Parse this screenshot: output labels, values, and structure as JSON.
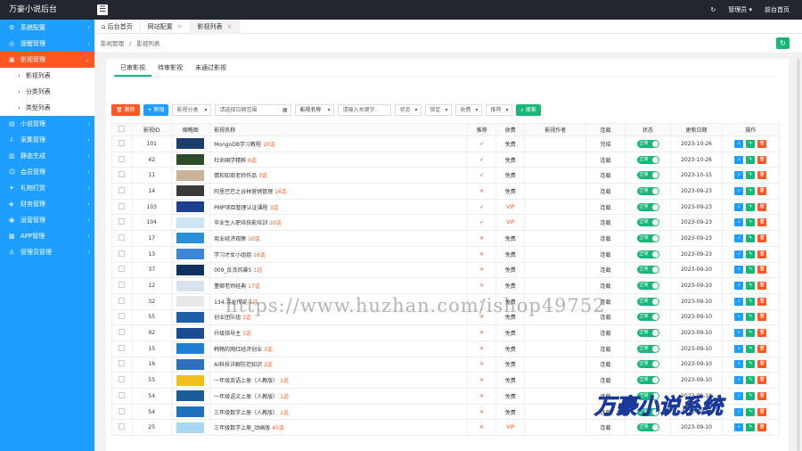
{
  "app": {
    "title": "万豪小说后台"
  },
  "top": {
    "user": "管理员 ▾",
    "home": "前台首页"
  },
  "sidebar": {
    "items": [
      {
        "label": "系统配置",
        "icon": "gear-icon"
      },
      {
        "label": "提醒管理",
        "icon": "bell-icon"
      },
      {
        "label": "影视管理",
        "icon": "film-icon"
      },
      {
        "label": "小说管理",
        "icon": "book-icon"
      },
      {
        "label": "采集管理",
        "icon": "download-icon"
      },
      {
        "label": "静态生成",
        "icon": "file-icon"
      },
      {
        "label": "会员管理",
        "icon": "user-icon"
      },
      {
        "label": "礼物打赏",
        "icon": "gift-icon"
      },
      {
        "label": "财务管理",
        "icon": "wallet-icon"
      },
      {
        "label": "运营管理",
        "icon": "chart-icon"
      },
      {
        "label": "APP管理",
        "icon": "app-icon"
      },
      {
        "label": "管理员管理",
        "icon": "admin-icon"
      }
    ],
    "sub": [
      "影视列表",
      "分类列表",
      "类型列表"
    ]
  },
  "tabs": [
    "后台首页",
    "网站配置",
    "影视列表"
  ],
  "crumb": {
    "a": "影视管理",
    "sep": "/",
    "b": "影视列表"
  },
  "subtabs": [
    "已审影视",
    "待审影视",
    "未通过影视"
  ],
  "toolbar": {
    "del": "删除",
    "add": "+ 新增",
    "cat": "影视分类",
    "date_ph": "请选择日期范围",
    "name_lab": "影视名称",
    "kw_ph": "请输入关键字",
    "status": "状态",
    "lock": "锁定",
    "fee": "收费",
    "rec": "推荐",
    "search": "搜索"
  },
  "table": {
    "headers": [
      "影视ID",
      "缩略图",
      "影视名称",
      "推荐",
      "收费",
      "影视作者",
      "连载",
      "状态",
      "更新日期",
      "操作"
    ],
    "rows": [
      {
        "id": "101",
        "name": "MongoDB学习教程",
        "ep": "10话",
        "rec": "✓",
        "fee": "免费",
        "serial": "完结",
        "date": "2023-10-26",
        "thumb": "#1c3d6e"
      },
      {
        "id": "42",
        "name": "杜命国学精粹",
        "ep": "6话",
        "rec": "✓",
        "fee": "免费",
        "serial": "连载",
        "date": "2023-10-26",
        "thumb": "#2d4a2a"
      },
      {
        "id": "11",
        "name": "情和知商老师作品",
        "ep": "3话",
        "rec": "✓",
        "fee": "免费",
        "serial": "连载",
        "date": "2023-10-15",
        "thumb": "#c9b39a"
      },
      {
        "id": "14",
        "name": "阿里巴巴之谷林营销管理",
        "ep": "16话",
        "rec": "✕",
        "fee": "免费",
        "serial": "连载",
        "date": "2023-09-23",
        "thumb": "#3a3a3a"
      },
      {
        "id": "103",
        "name": "PMP项目管理认证课程",
        "ep": "3话",
        "rec": "✓",
        "fee": "VIP",
        "serial": "连载",
        "date": "2023-09-23",
        "thumb": "#1d3f8f"
      },
      {
        "id": "104",
        "name": "毕业生入职培技能培训",
        "ep": "10话",
        "rec": "✓",
        "fee": "VIP",
        "serial": "连载",
        "date": "2023-09-23",
        "thumb": "#cfe5f4"
      },
      {
        "id": "17",
        "name": "商业经济观察",
        "ep": "10话",
        "rec": "✕",
        "fee": "免费",
        "serial": "连载",
        "date": "2023-09-23",
        "thumb": "#2a8fd6"
      },
      {
        "id": "13",
        "name": "学习才女小组姐",
        "ep": "16话",
        "rec": "✕",
        "fee": "免费",
        "serial": "连载",
        "date": "2023-09-23",
        "thumb": "#3c86d8"
      },
      {
        "id": "37",
        "name": "009_反贪风暴5",
        "ep": "1话",
        "rec": "✕",
        "fee": "免费",
        "serial": "连载",
        "date": "2023-09-10",
        "thumb": "#103060"
      },
      {
        "id": "12",
        "name": "董卿老师经典",
        "ep": "17话",
        "rec": "✕",
        "fee": "免费",
        "serial": "连载",
        "date": "2023-09-10",
        "thumb": "#d8e2ec"
      },
      {
        "id": "32",
        "name": "134.寻龙传说",
        "ep": "1话",
        "rec": "✓",
        "fee": "免费",
        "serial": "连载",
        "date": "2023-09-10",
        "thumb": "#e8e8e8"
      },
      {
        "id": "55",
        "name": "创业团队组",
        "ep": "1话",
        "rec": "✕",
        "fee": "免费",
        "serial": "连载",
        "date": "2023-09-10",
        "thumb": "#1f5fa8"
      },
      {
        "id": "92",
        "name": "升级指导主",
        "ep": "1话",
        "rec": "✕",
        "fee": "免费",
        "serial": "连载",
        "date": "2023-09-10",
        "thumb": "#1a4a90"
      },
      {
        "id": "15",
        "name": "韩畅的网红经济创业",
        "ep": "3话",
        "rec": "✕",
        "fee": "免费",
        "serial": "连载",
        "date": "2023-09-10",
        "thumb": "#1e7fd0"
      },
      {
        "id": "16",
        "name": "AI科技详解防范知识",
        "ep": "2话",
        "rec": "✕",
        "fee": "免费",
        "serial": "连载",
        "date": "2023-09-10",
        "thumb": "#2f6fc0"
      },
      {
        "id": "55",
        "name": "一年级英语上册（人教版）",
        "ep": "1话",
        "rec": "✕",
        "fee": "免费",
        "serial": "连载",
        "date": "2023-09-10",
        "thumb": "#f0c020"
      },
      {
        "id": "54",
        "name": "一年级语文上册（人教版）",
        "ep": "1话",
        "rec": "✕",
        "fee": "免费",
        "serial": "连载",
        "date": "2023-09-10",
        "thumb": "#1b5c9a"
      },
      {
        "id": "54",
        "name": "三年级数学上册（人教版）",
        "ep": "1话",
        "rec": "✕",
        "fee": "免费",
        "serial": "连载",
        "date": "2023-09-10",
        "thumb": "#2070c0"
      },
      {
        "id": "25",
        "name": "三年级数学上册_动画版",
        "ep": "45话",
        "rec": "✕",
        "fee": "VIP",
        "serial": "连载",
        "date": "2023-09-10",
        "thumb": "#a8d8f0"
      }
    ],
    "status_label": "正常"
  },
  "watermark": "https://www.huzhan.com/ishop49752",
  "brand": "万豪小说系统"
}
